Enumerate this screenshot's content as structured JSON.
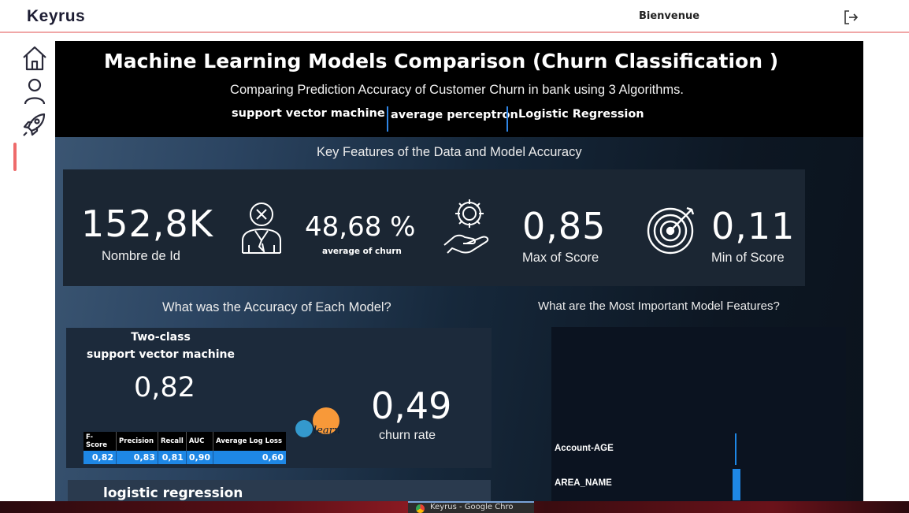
{
  "app": {
    "logo": "Keyrus",
    "welcome": "Bienvenue"
  },
  "nav": {
    "items": [
      {
        "icon": "home-icon"
      },
      {
        "icon": "user-icon"
      },
      {
        "icon": "rocket-icon",
        "active": true
      }
    ],
    "accent_color": "#ee6a6a"
  },
  "report": {
    "title": "Machine Learning Models Comparison (Churn Classification )",
    "subtitle": "Comparing Prediction Accuracy of Customer Churn in bank using 3 Algorithms.",
    "algorithms": [
      "support vector machine",
      "average perceptron",
      "Logistic Regression"
    ],
    "key_features_heading": "Key Features of the Data and Model Accuracy",
    "kpis": {
      "count_value": "152,8K",
      "count_label": "Nombre de Id",
      "churn_value": "48,68 %",
      "churn_label": "average of churn",
      "max_value": "0,85",
      "max_label": "Max of Score",
      "min_value": "0,11",
      "min_label": "Min of Score"
    },
    "accuracy_heading": "What was the Accuracy of Each Model?",
    "features_heading": "What are the Most Important Model Features?",
    "svm_panel": {
      "title_line1": "Two-class",
      "title_line2": "support vector machine",
      "accuracy": "0,82",
      "churn_rate_value": "0,49",
      "churn_rate_label": "churn rate",
      "table": {
        "headers": [
          "F-Score",
          "Precision",
          "Recall",
          "AUC",
          "Average Log Loss"
        ],
        "values": [
          "0,82",
          "0,83",
          "0,81",
          "0,90",
          "0,60"
        ]
      },
      "logo_text": "learn"
    },
    "lr_panel": {
      "title": "logistic regression"
    },
    "feature_importance": [
      {
        "name": "Account-AGE",
        "bar": 0.06
      },
      {
        "name": "AREA_NAME",
        "bar": 0.25
      }
    ],
    "accent_color": "#1e87e5"
  },
  "taskbar": {
    "active_window": "Keyrus - Google Chro"
  }
}
